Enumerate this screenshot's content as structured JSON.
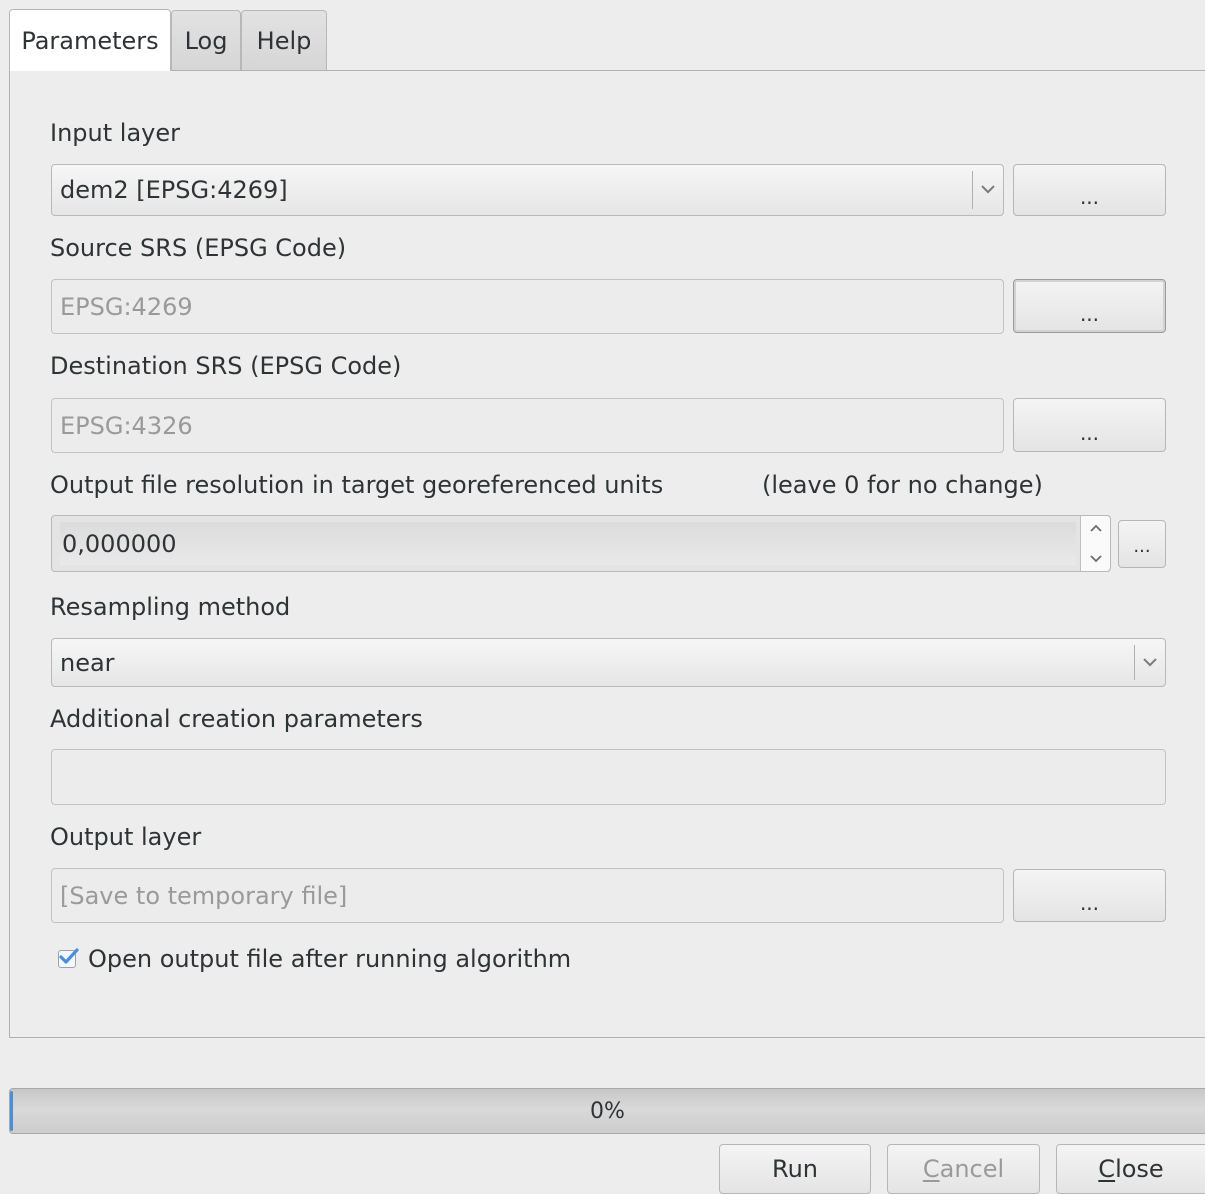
{
  "tabs": [
    {
      "label": "Parameters",
      "active": true
    },
    {
      "label": "Log",
      "active": false
    },
    {
      "label": "Help",
      "active": false
    }
  ],
  "fields": {
    "input_layer": {
      "label": "Input layer",
      "value": "dem2 [EPSG:4269]",
      "button": "..."
    },
    "source_srs": {
      "label": "Source SRS (EPSG Code)",
      "value": "EPSG:4269",
      "button": "..."
    },
    "dest_srs": {
      "label": "Destination SRS (EPSG Code)",
      "value": "EPSG:4326",
      "button": "..."
    },
    "resolution": {
      "label": "Output file resolution in target georeferenced units",
      "hint": "(leave 0 for no change)",
      "value": "0,000000",
      "button": "..."
    },
    "resampling": {
      "label": "Resampling method",
      "value": "near"
    },
    "creation_params": {
      "label": "Additional creation parameters",
      "value": ""
    },
    "output_layer": {
      "label": "Output layer",
      "placeholder": "[Save to temporary file]",
      "button": "..."
    }
  },
  "open_output": {
    "label": "Open output file after running algorithm",
    "checked": true
  },
  "progress": {
    "text": "0%",
    "value": 0
  },
  "buttons": {
    "run": "Run",
    "cancel_first": "C",
    "cancel_rest": "ancel",
    "close_first": "C",
    "close_rest": "lose"
  },
  "colors": {
    "check_accent": "#4a90d9",
    "disabled_text": "#9a9a9a"
  }
}
